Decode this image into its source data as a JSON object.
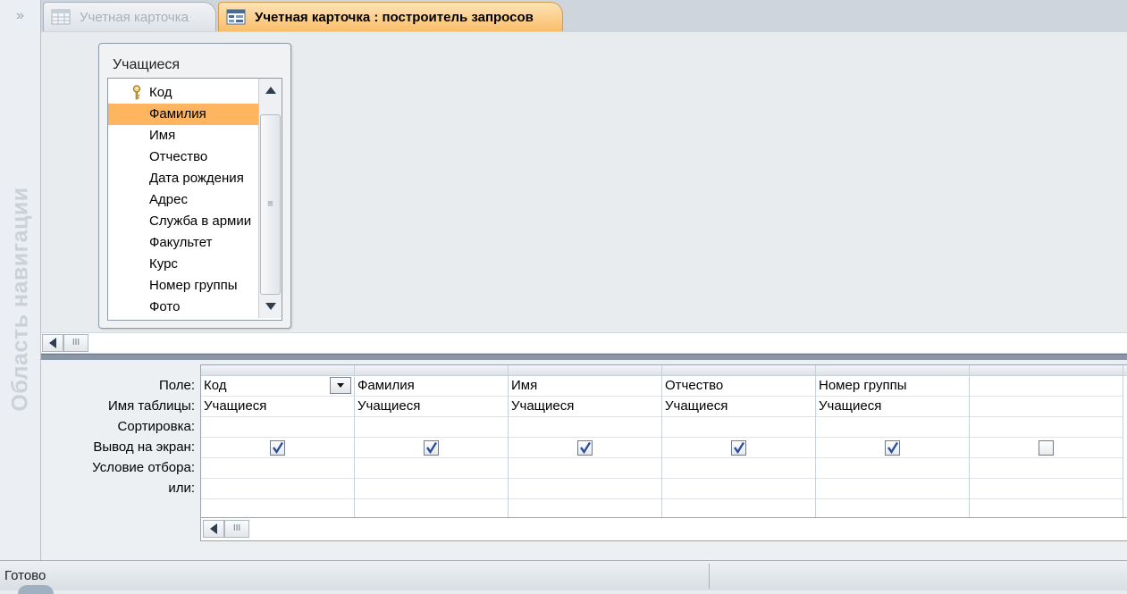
{
  "nav": {
    "toggle": "»",
    "title": "Область навигации"
  },
  "tabs": [
    {
      "label": "Учетная карточка",
      "active": false,
      "icon": "table-icon"
    },
    {
      "label": "Учетная карточка : построитель запросов",
      "active": true,
      "icon": "query-design-icon"
    }
  ],
  "table_box": {
    "title": "Учащиеся",
    "fields": [
      {
        "label": "Код",
        "primary_key": true
      },
      {
        "label": "Фамилия",
        "selected": true
      },
      {
        "label": "Имя"
      },
      {
        "label": "Отчество"
      },
      {
        "label": "Дата рождения"
      },
      {
        "label": "Адрес"
      },
      {
        "label": "Служба в армии"
      },
      {
        "label": "Факультет"
      },
      {
        "label": "Курс"
      },
      {
        "label": "Номер группы"
      },
      {
        "label": "Фото"
      }
    ],
    "scroll_grip": "≡"
  },
  "scroll_grip_h": "III",
  "grid": {
    "row_labels": [
      "Поле:",
      "Имя таблицы:",
      "Сортировка:",
      "Вывод на экран:",
      "Условие отбора:",
      "или:"
    ],
    "columns": [
      {
        "field": "Код",
        "table": "Учащиеся",
        "sort": "",
        "show": true,
        "criteria": "",
        "or": ""
      },
      {
        "field": "Фамилия",
        "table": "Учащиеся",
        "sort": "",
        "show": true,
        "criteria": "",
        "or": ""
      },
      {
        "field": "Имя",
        "table": "Учащиеся",
        "sort": "",
        "show": true,
        "criteria": "",
        "or": ""
      },
      {
        "field": "Отчество",
        "table": "Учащиеся",
        "sort": "",
        "show": true,
        "criteria": "",
        "or": ""
      },
      {
        "field": "Номер группы",
        "table": "Учащиеся",
        "sort": "",
        "show": true,
        "criteria": "",
        "or": ""
      },
      {
        "field": "",
        "table": "",
        "sort": "",
        "show": false,
        "criteria": "",
        "or": ""
      }
    ]
  },
  "status": {
    "text": "Готово"
  },
  "colors": {
    "active_tab": "#f9be6a",
    "selected_field": "#fdb560",
    "check": "#2f4f9e"
  }
}
